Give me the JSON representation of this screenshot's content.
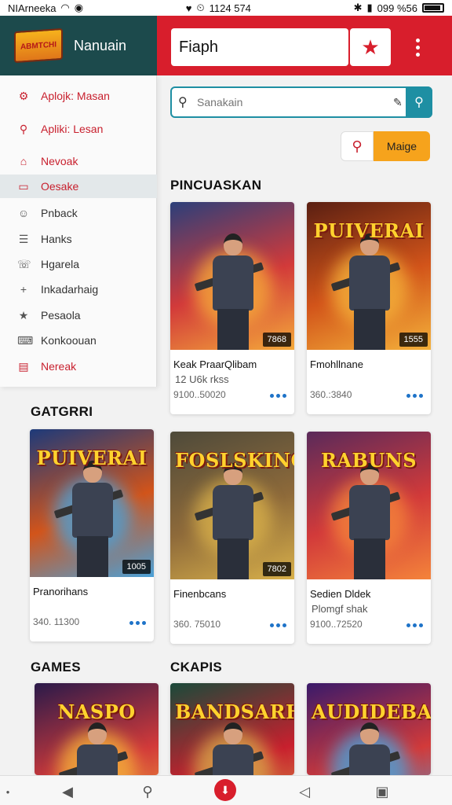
{
  "status_bar": {
    "carrier": "NIArneeka",
    "time": "1124 574",
    "right": "099 %56"
  },
  "header": {
    "app_name": "Nanuain",
    "logo_text": "ABMTCHI",
    "title": "Fiaph"
  },
  "sidebar": {
    "items": [
      {
        "label": "Aplojk: Masan",
        "icon": "gear-icon",
        "style": "red"
      },
      {
        "label": "Apliki: Lesan",
        "icon": "location-pin-icon",
        "style": "red"
      },
      {
        "label": "Nevoak",
        "icon": "bag-icon",
        "style": "red"
      },
      {
        "label": "Oesake",
        "icon": "clipboard-icon",
        "style": "red-active"
      },
      {
        "label": "Pnback",
        "icon": "user-icon",
        "style": "normal"
      },
      {
        "label": "Hanks",
        "icon": "list-icon",
        "style": "normal"
      },
      {
        "label": "Hgarela",
        "icon": "phone-icon",
        "style": "normal"
      },
      {
        "label": "Inkadarhaig",
        "icon": "plus-icon",
        "style": "normal"
      },
      {
        "label": "Pesaola",
        "icon": "star-icon",
        "style": "normal"
      },
      {
        "label": "Konkoouan",
        "icon": "keyboard-icon",
        "style": "normal"
      },
      {
        "label": "Nereak",
        "icon": "panel-icon",
        "style": "red"
      }
    ]
  },
  "search": {
    "placeholder": "Sanakain"
  },
  "image_button_label": "Maige",
  "sections": {
    "pincuaskan": "PINCUASKAN",
    "gatgrri": "GATGRRI",
    "games": "GAMES",
    "ckapis": "CKAPIS"
  },
  "cards": [
    {
      "name": "Keak PraarQlibam",
      "sub": "12 U6k rkss",
      "price": "9100..50020",
      "badge": "7868",
      "art_title": "",
      "palette": [
        "#2b3f7a",
        "#d23a3a",
        "#f4a93a"
      ]
    },
    {
      "name": "Fmohllnane",
      "sub": "",
      "price": "360.:3840",
      "badge": "1555",
      "art_title": "PUIVERAI",
      "palette": [
        "#5a1f12",
        "#d2541a",
        "#f4b13a"
      ]
    },
    {
      "name": "Pranorihans",
      "sub": "",
      "price": "340. 11300",
      "badge": "1005",
      "art_title": "PUIVERAI",
      "palette": [
        "#1d3a7a",
        "#d2541a",
        "#4aa1d8"
      ]
    },
    {
      "name": "Finenbcans",
      "sub": "",
      "price": "360. 75010",
      "badge": "7802",
      "art_title": "FOSLSKING",
      "palette": [
        "#4e4a3a",
        "#8e6a3a",
        "#d8b04a"
      ]
    },
    {
      "name": "Sedien Dldek",
      "sub": "Plomgf shak",
      "price": "9100..72520",
      "badge": "",
      "art_title": "RABUNS",
      "palette": [
        "#5a2a5a",
        "#d23a3a",
        "#f4833a"
      ]
    },
    {
      "name": "",
      "sub": "",
      "price": "",
      "badge": "",
      "art_title": "NASPO",
      "palette": [
        "#2a1a4a",
        "#d23a3a",
        "#f4b13a"
      ]
    },
    {
      "name": "",
      "sub": "",
      "price": "",
      "badge": "",
      "art_title": "BANDSARH",
      "palette": [
        "#1a4a3a",
        "#c8202e",
        "#d8a84a"
      ]
    },
    {
      "name": "",
      "sub": "",
      "price": "",
      "badge": "",
      "art_title": "AUDIDEBA",
      "palette": [
        "#3a1a6a",
        "#d23a3a",
        "#4aa1d8"
      ]
    }
  ]
}
